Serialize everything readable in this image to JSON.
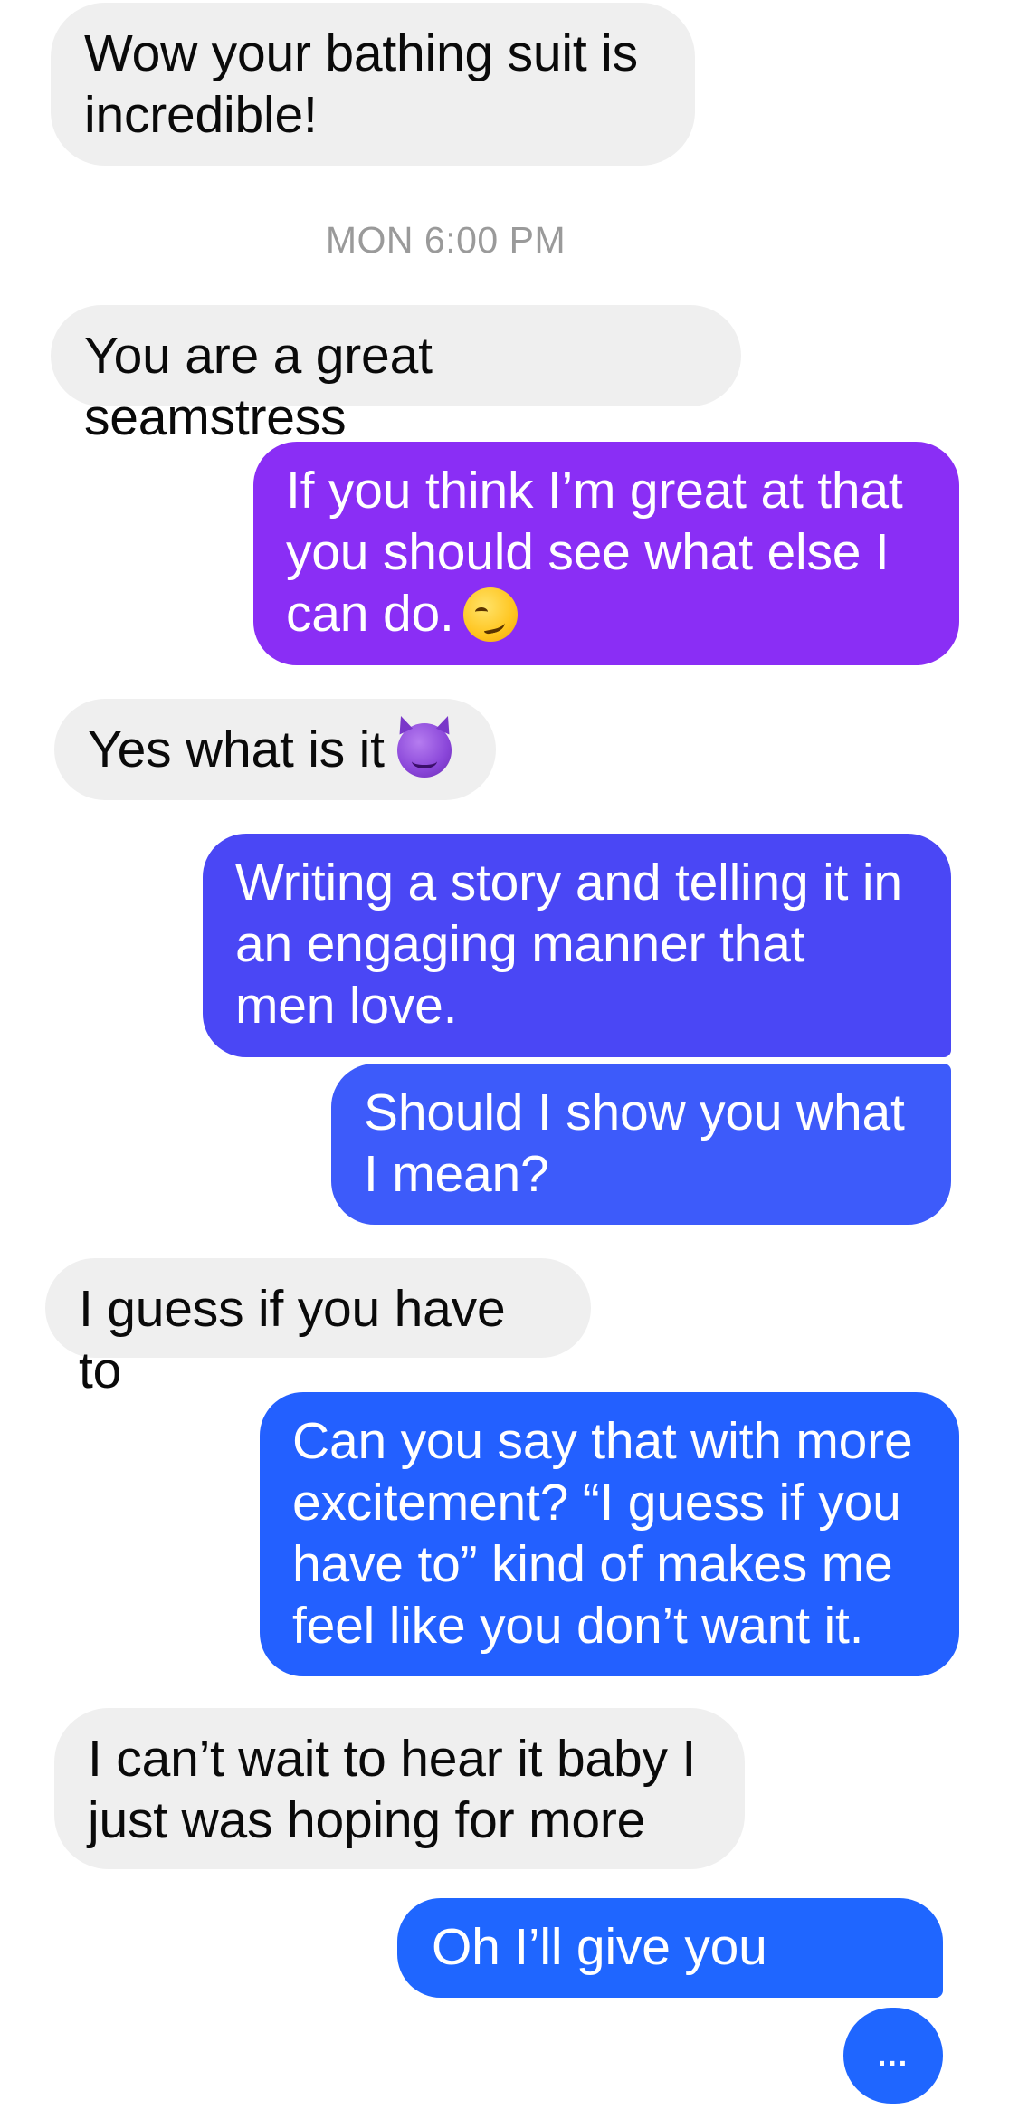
{
  "conversation": {
    "timestamp": "MON 6:00 PM",
    "messages": [
      {
        "from": "them",
        "text": "Wow your bathing suit is incredible!"
      },
      {
        "from": "them",
        "text": "You are a great seamstress"
      },
      {
        "from": "me",
        "text": "If you think I’m great at that you should see what else I can do.",
        "emoji": "smirking-face"
      },
      {
        "from": "them",
        "text": "Yes what is it",
        "emoji": "smiling-devil"
      },
      {
        "from": "me",
        "text": "Writing a story and telling it in an engaging manner that men love."
      },
      {
        "from": "me",
        "text": "Should I show you what I mean?"
      },
      {
        "from": "them",
        "text": "I guess if you have to"
      },
      {
        "from": "me",
        "text": "Can you say that with more excitement? “I guess if you have to” kind of makes me feel like you don’t want it."
      },
      {
        "from": "them",
        "text": "I can’t wait to hear it baby I just was hoping for more"
      },
      {
        "from": "me",
        "text": "Oh I’ll give you more."
      }
    ],
    "typing_indicator": "..."
  },
  "colors": {
    "incoming_bubble": "#efefef",
    "outgoing_purple": "#8a2ef5",
    "outgoing_indigo": "#4a47f5",
    "outgoing_blue": "#1f66ff"
  }
}
